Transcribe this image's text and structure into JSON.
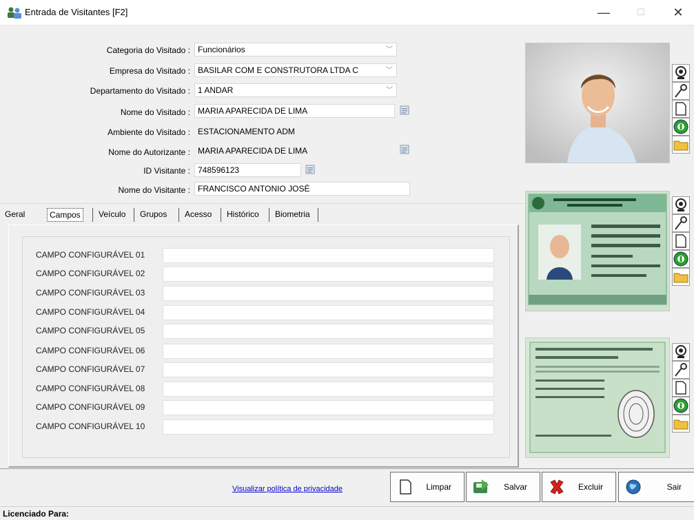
{
  "window": {
    "title": "Entrada de Visitantes [F2]",
    "minimize": "—",
    "maximize": "☐",
    "close": "✕"
  },
  "form": {
    "categoria_label": "Categoria do Visitado :",
    "categoria_value": "Funcionários",
    "empresa_label": "Empresa do Visitado :",
    "empresa_value": "BASILAR COM E CONSTRUTORA LTDA C",
    "departamento_label": "Departamento do Visitado :",
    "departamento_value": "1 ANDAR",
    "nome_visitado_label": "Nome do Visitado :",
    "nome_visitado_value": "MARIA APARECIDA DE LIMA",
    "ambiente_label": "Ambiente do Visitado :",
    "ambiente_value": "ESTACIONAMENTO ADM",
    "autorizante_label": "Nome do Autorizante :",
    "autorizante_value": "MARIA APARECIDA DE LIMA",
    "id_label": "ID Visitante :",
    "id_value": "748596123",
    "nome_visitante_label": "Nome do Visitante :",
    "nome_visitante_value": "FRANCISCO ANTONIO JOSÉ"
  },
  "tabs": [
    {
      "label": "Geral"
    },
    {
      "label": "Campos"
    },
    {
      "label": "Veículo"
    },
    {
      "label": "Grupos"
    },
    {
      "label": "Acesso"
    },
    {
      "label": "Histórico"
    },
    {
      "label": "Biometria"
    }
  ],
  "campos": [
    {
      "label": "CAMPO CONFIGURÁVEL 01",
      "value": ""
    },
    {
      "label": "CAMPO CONFIGURÁVEL 02",
      "value": ""
    },
    {
      "label": "CAMPO CONFIGURÁVEL 03",
      "value": ""
    },
    {
      "label": "CAMPO CONFIGURÁVEL 04",
      "value": ""
    },
    {
      "label": "CAMPO CONFIGURÁVEL 05",
      "value": ""
    },
    {
      "label": "CAMPO CONFIGURÁVEL 06",
      "value": ""
    },
    {
      "label": "CAMPO CONFIGURÁVEL 07",
      "value": ""
    },
    {
      "label": "CAMPO CONFIGURÁVEL 08",
      "value": ""
    },
    {
      "label": "CAMPO CONFIGURÁVEL 09",
      "value": ""
    },
    {
      "label": "CAMPO CONFIGURÁVEL 10",
      "value": ""
    }
  ],
  "footer": {
    "privacy_link": "Visualizar política de privacidade",
    "limpar": "Limpar",
    "salvar": "Salvar",
    "excluir": "Excluir",
    "sair": "Sair",
    "licensed": "Licenciado Para:"
  },
  "colors": {
    "link": "#0000cc",
    "folder": "#f0c040",
    "green": "#2e9e2e",
    "delete_red": "#d42020"
  }
}
